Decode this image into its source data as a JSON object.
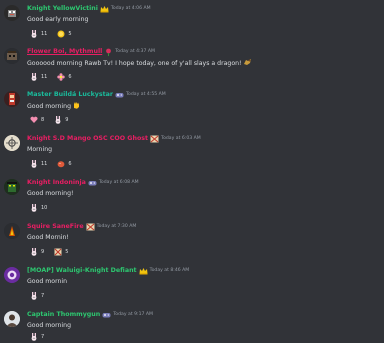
{
  "channel": {
    "messages": [
      {
        "author": "Knight YellowVictini",
        "author_color": "#2dc770",
        "badge_icon": "crown-role-icon",
        "timestamp": "Today at 4:06 AM",
        "text": "Good early morning",
        "reactions": [
          {
            "icon": "bunny-emoji-icon",
            "count": "11"
          },
          {
            "icon": "yellow-coin-emoji-icon",
            "count": "5"
          }
        ]
      },
      {
        "author": "Flower Boi, Mythmull",
        "author_color": "#e91e63",
        "badge_icon": "rose-role-icon",
        "timestamp": "Today at 4:37 AM",
        "text": "Goooood morning Rawb Tv! I hope today, one of y'all slays a dragon!",
        "text_emoji": "dragon-rider-emoji-icon",
        "reactions": [
          {
            "icon": "bunny-emoji-icon",
            "count": "11"
          },
          {
            "icon": "flower-emoji-icon",
            "count": "6"
          }
        ]
      },
      {
        "author": "Master Buildá Luckystar",
        "author_color": "#1abc9c",
        "badge_icon": "controller-role-icon",
        "timestamp": "Today at 4:55 AM",
        "text": "Good morning",
        "text_emoji": "waving-hand-emoji-icon",
        "reactions": [
          {
            "icon": "pink-heart-emoji-icon",
            "count": "8"
          },
          {
            "icon": "bunny-emoji-icon",
            "count": "9"
          }
        ]
      },
      {
        "author": "Knight S.D Mango OSC COO Ghost",
        "author_color": "#e91e63",
        "badge_icon": "badge-role-icon",
        "timestamp": "Today at 6:03 AM",
        "text": "Morning",
        "reactions": [
          {
            "icon": "bunny-emoji-icon",
            "count": "11"
          },
          {
            "icon": "red-blob-emoji-icon",
            "count": "6"
          }
        ]
      },
      {
        "author": "Knight Indoninja",
        "author_color": "#e91e63",
        "badge_icon": "controller-role-icon",
        "timestamp": "Today at 6:08 AM",
        "text": "Good morning!",
        "reactions": [
          {
            "icon": "bunny-emoji-icon",
            "count": "10"
          }
        ]
      },
      {
        "author": "Squire SaneFire",
        "author_color": "#e91e63",
        "badge_icon": "badge-role-icon",
        "timestamp": "Today at 7:30 AM",
        "text": "Good Mornin!",
        "reactions": [
          {
            "icon": "bunny-emoji-icon",
            "count": "9"
          },
          {
            "icon": "badge-emoji-icon",
            "count": "5"
          }
        ]
      },
      {
        "author": "[MOAP] Waluigi-Knight Defiant",
        "author_color": "#2dc770",
        "badge_icon": "crown-role-icon",
        "timestamp": "Today at 8:46 AM",
        "text": "Good mornin",
        "reactions": [
          {
            "icon": "bunny-emoji-icon",
            "count": "7"
          }
        ]
      },
      {
        "author": "Captain Thommygun",
        "author_color": "#2dc770",
        "badge_icon": "controller-role-icon",
        "timestamp": "Today at 9:17 AM",
        "text": "Good morning",
        "reactions": [
          {
            "icon": "bunny-emoji-icon",
            "count": "7"
          }
        ]
      }
    ]
  }
}
